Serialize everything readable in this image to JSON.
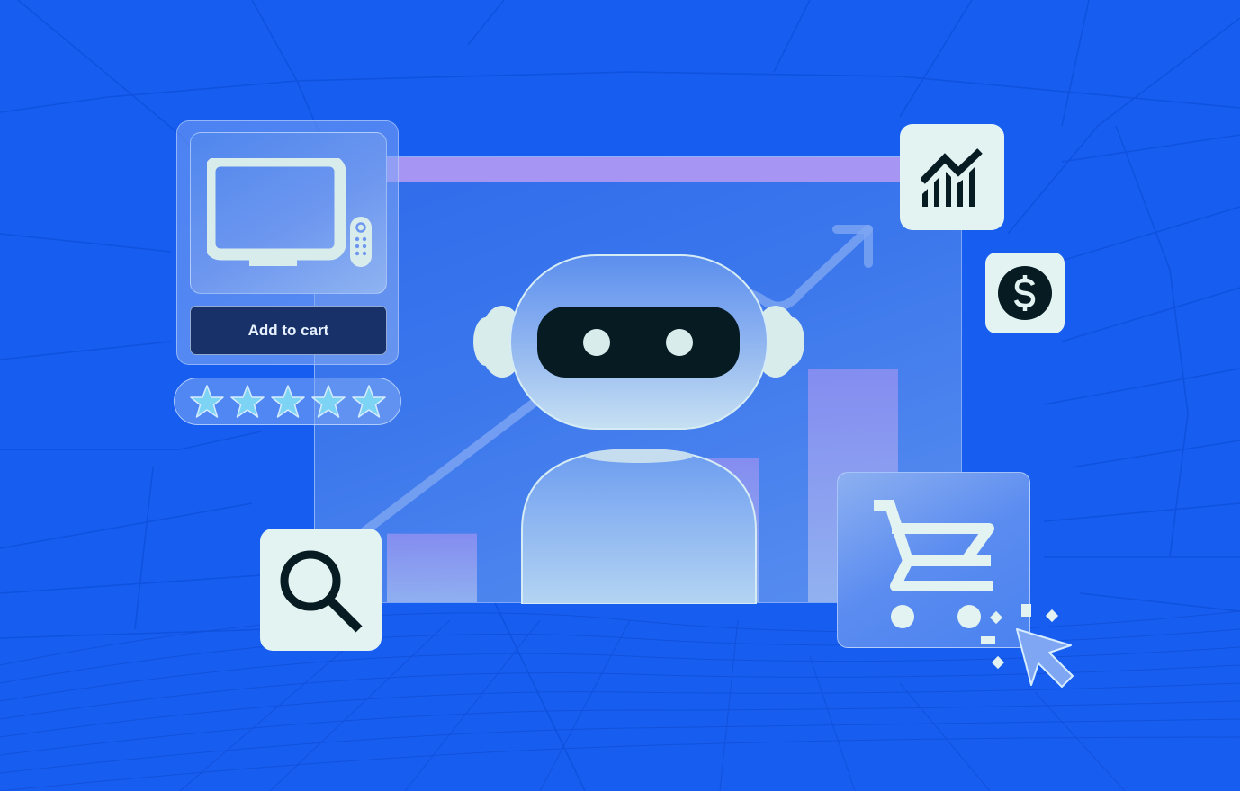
{
  "scene": {
    "title": "AI shopping assistant illustration",
    "colors": {
      "background": "#175df0",
      "accent_bar": "#a695f2",
      "tile": "#e2f3f2",
      "icon_dark": "#071c22",
      "button": "#183269",
      "star": "#7dd3f4"
    }
  },
  "product_card": {
    "image_icon": "tv-with-remote-icon",
    "button_label": "Add to cart",
    "rating": {
      "stars_filled": 5,
      "stars_total": 5
    }
  },
  "tiles": [
    {
      "name": "analytics",
      "icon": "growth-chart-icon"
    },
    {
      "name": "price",
      "icon": "dollar-icon"
    },
    {
      "name": "search",
      "icon": "search-icon"
    },
    {
      "name": "cart",
      "icon": "shopping-cart-icon"
    }
  ],
  "dashboard": {
    "bars_relative_height": [
      0.27,
      0.56,
      0.9
    ]
  },
  "robot": {
    "eyes": 2
  }
}
